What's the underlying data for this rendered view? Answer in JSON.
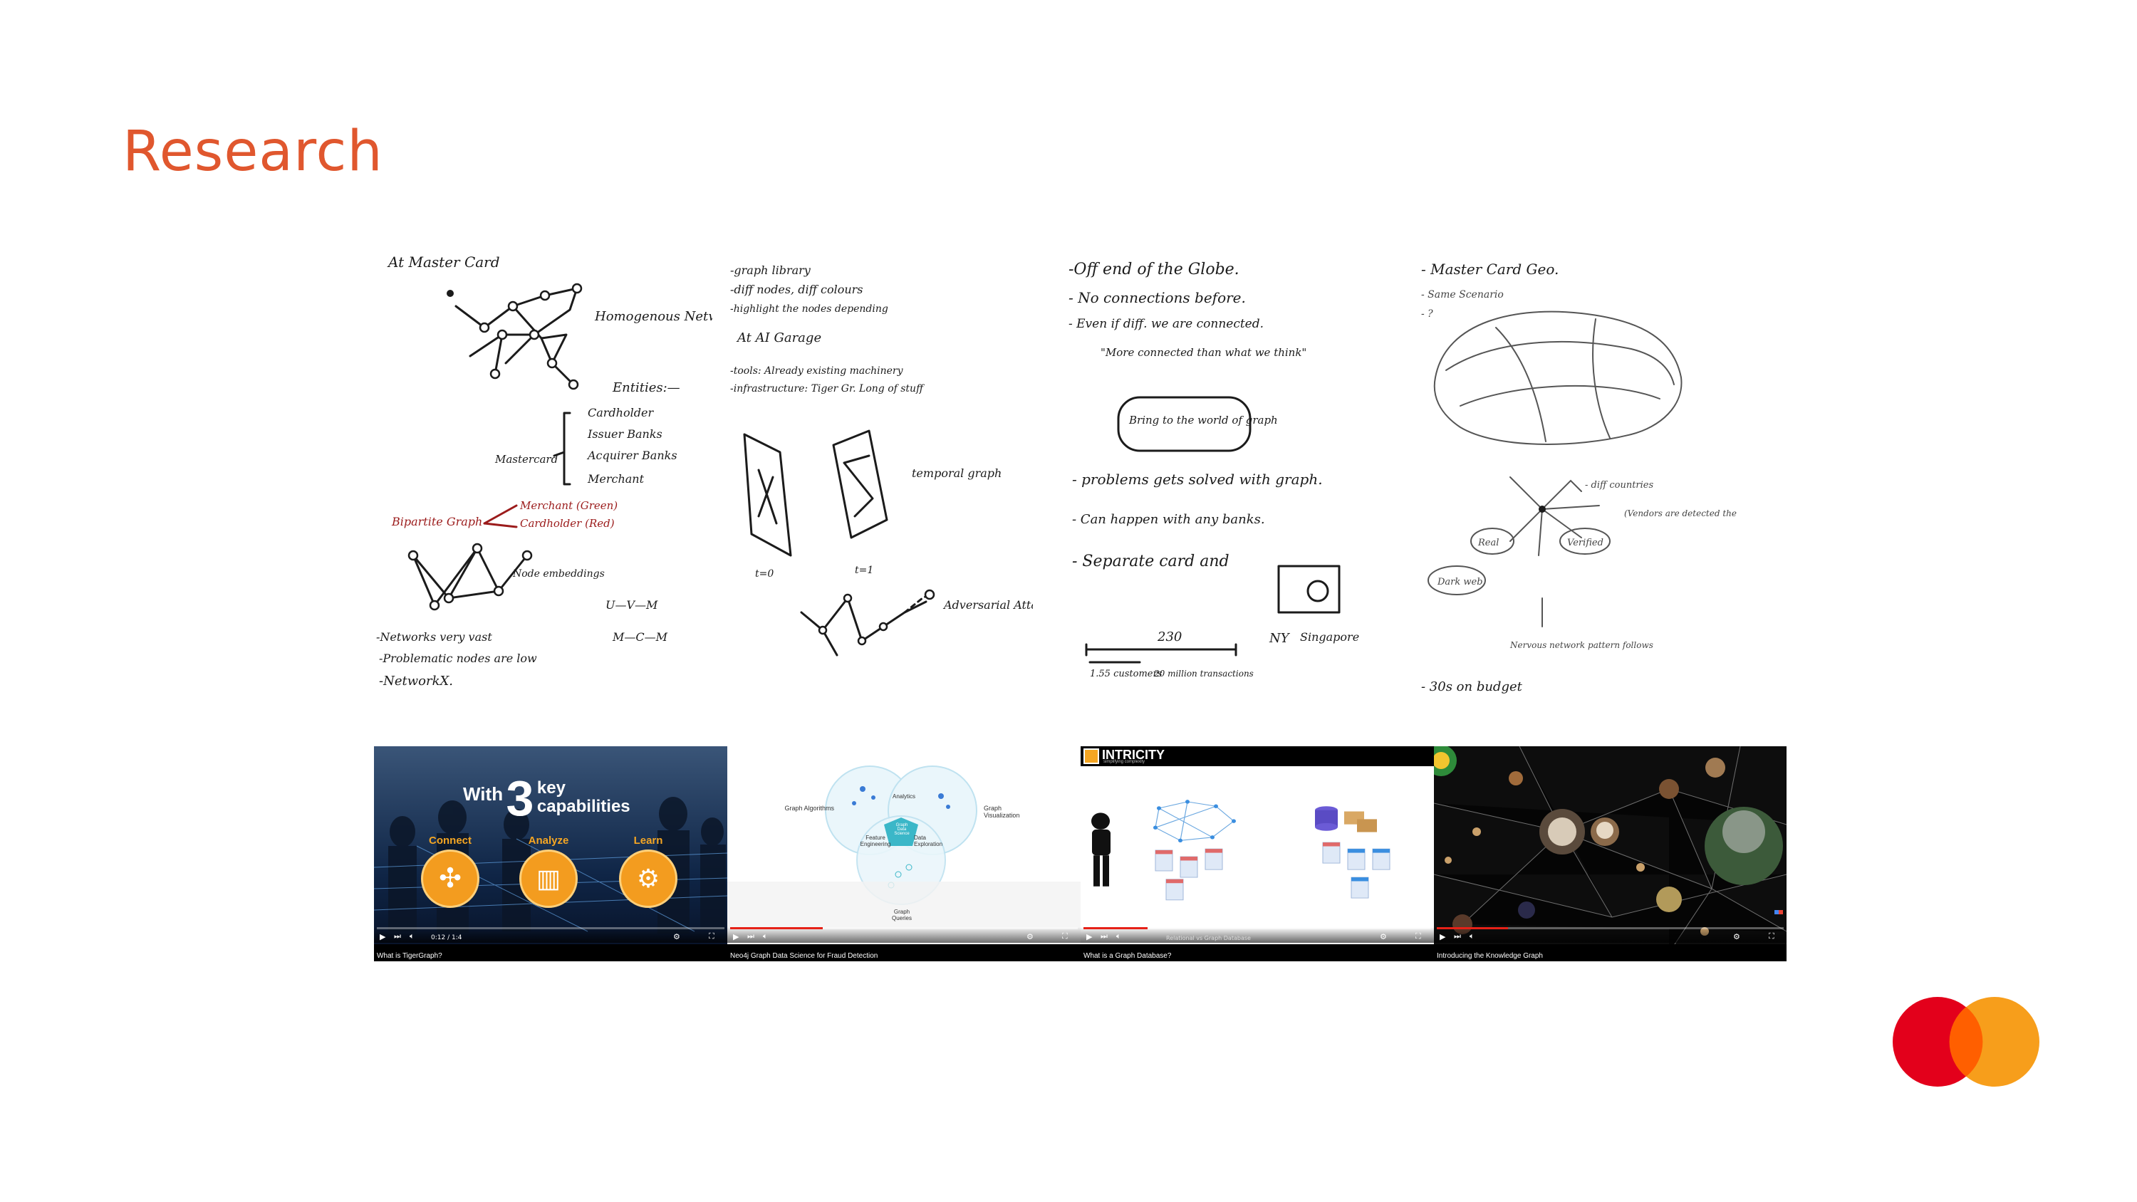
{
  "slide": {
    "title": "Research",
    "accent_color": "#e0572e"
  },
  "sketches": [
    {
      "texts": [
        "At Master Card",
        "Homogenous Network",
        "Entities:—",
        "Cardholder",
        "Issuer Banks",
        "Acquirer Banks",
        "Merchant",
        "Mastercard",
        "Merchant (Green)",
        "Cardholder (Red)",
        "Bipartite Graph",
        "Node embeddings",
        "U—V—M",
        "M—C—M",
        "-Networks very vast",
        "-Problematic nodes are low",
        "-NetworkX."
      ]
    },
    {
      "texts": [
        "-graph library",
        "-diff nodes, diff colours",
        "-highlight the nodes depending",
        "At AI Garage",
        "-tools: Already existing machinery",
        "-infrastructure: Tiger Gr. Long of stuff",
        "temporal graph",
        "t=0",
        "t=1",
        "Adversarial Attack"
      ]
    },
    {
      "texts": [
        "-Off end of the Globe.",
        "- No connections before.",
        "- Even if diff. we are connected.",
        "\"More connected than what we think\"",
        "Bring to the world of graph",
        "- problems gets solved with graph.",
        "- Can happen with any banks.",
        "- Separate card and",
        "NY",
        "Singapore",
        "230",
        "1.55 customers",
        "20 million transactions"
      ]
    },
    {
      "texts": [
        "- Master Card Geo.",
        "- Same Scenario",
        "- ?",
        "- diff countries",
        "Real",
        "Verified",
        "(Vendors are detected the Mercs)",
        "Dark web",
        "Nervous network pattern follows",
        "- 30s on budget"
      ]
    }
  ],
  "videos": [
    {
      "caption": "What is TigerGraph?",
      "headline_prefix": "With",
      "headline_number": "3",
      "headline_line1": "key",
      "headline_line2": "capabilities",
      "labels": [
        "Connect",
        "Analyze",
        "Learn"
      ],
      "time": "0:12 / 1:4"
    },
    {
      "caption": "Neo4j Graph Data Science for Fraud Detection",
      "labels": [
        "Graph Algorithms",
        "Analytics",
        "Graph Visualization",
        "Feature Engineering",
        "Graph Data Science",
        "Data Exploration",
        "Graph Queries"
      ]
    },
    {
      "caption": "What is a Graph Database?",
      "brand": "INTRICITY",
      "brand_sub": "simplifying complexity",
      "subtitle": "Relational vs Graph Database"
    },
    {
      "caption": "Introducing the Knowledge Graph"
    }
  ],
  "icons": {
    "play": "play-icon",
    "next": "next-icon",
    "volume": "volume-icon",
    "settings": "gear-icon",
    "fullscreen": "fullscreen-icon"
  },
  "logo": {
    "name": "mastercard-logo",
    "red": "#e3001b",
    "orange": "#f79e1b",
    "overlap": "#ff5f00"
  }
}
